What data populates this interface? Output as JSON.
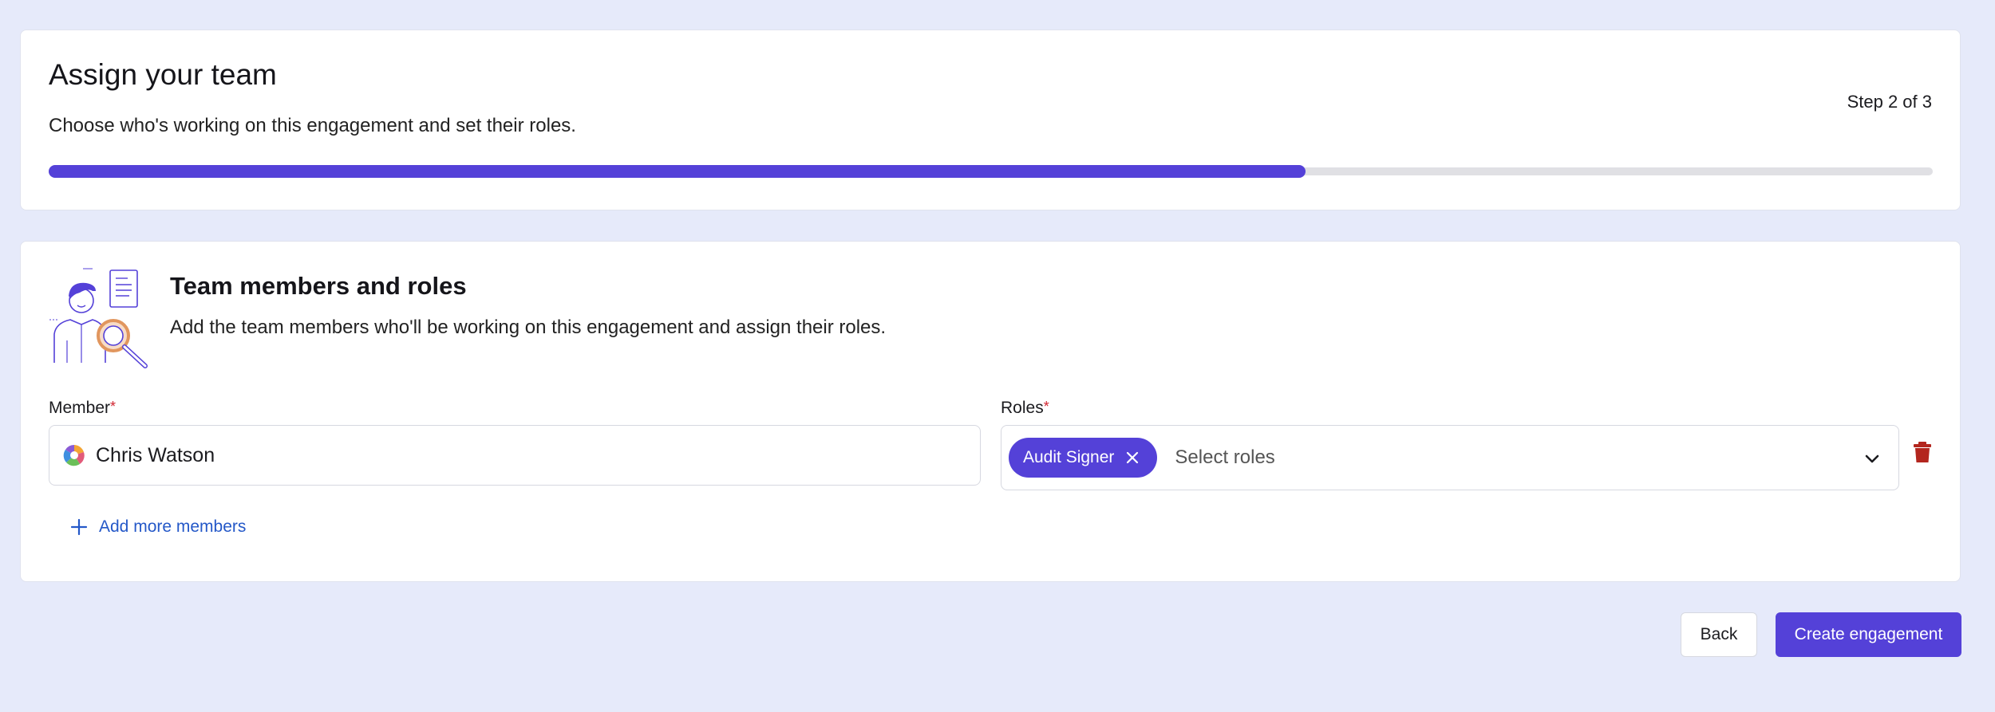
{
  "header": {
    "title": "Assign your team",
    "subtitle": "Choose who's working on this engagement and set their roles.",
    "step_label": "Step 2 of 3",
    "progress_fraction": 0.667
  },
  "team": {
    "title": "Team members and roles",
    "description": "Add the team members who'll be working on this engagement and assign their roles.",
    "member_label": "Member",
    "roles_label": "Roles",
    "required_marker": "*",
    "member_value": "Chris Watson",
    "selected_role": "Audit Signer",
    "roles_placeholder": "Select roles",
    "add_more_label": "Add more members"
  },
  "footer": {
    "back_label": "Back",
    "create_label": "Create engagement"
  },
  "colors": {
    "accent": "#5441d8",
    "background": "#e6eafa",
    "link": "#2458c8",
    "danger": "#b3261e",
    "required": "#d1242f"
  },
  "icons": {
    "illustration": "auditor-with-magnifier-illustration",
    "avatar": "user-avatar-icon",
    "chip_close": "close-icon",
    "dropdown": "chevron-down-icon",
    "delete": "trash-icon",
    "add": "plus-icon"
  }
}
